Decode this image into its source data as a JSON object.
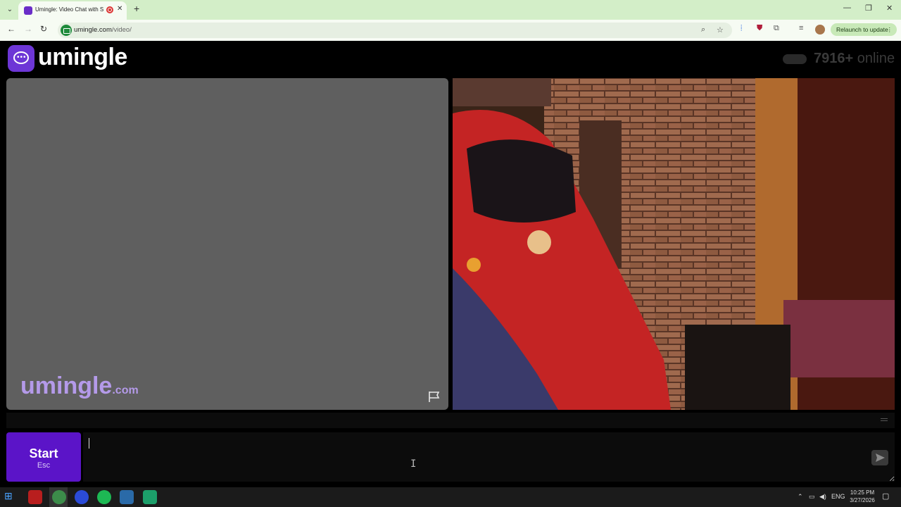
{
  "browser": {
    "tab_title": "Umingle: Video Chat with S",
    "url_host": "umingle.com",
    "url_path": "/video/",
    "relaunch_label": "Relaunch to update",
    "brand_color": "#6d36d6"
  },
  "header": {
    "logo_text": "umingle",
    "online_count": "7916+",
    "online_label": "online"
  },
  "video": {
    "watermark_name": "umingle",
    "watermark_domain": ".com"
  },
  "controls": {
    "start_label": "Start",
    "start_hint": "Esc",
    "chat_value": ""
  },
  "taskbar": {
    "lang": "ENG",
    "time": "10:25 PM",
    "date": "3/27/2026"
  }
}
